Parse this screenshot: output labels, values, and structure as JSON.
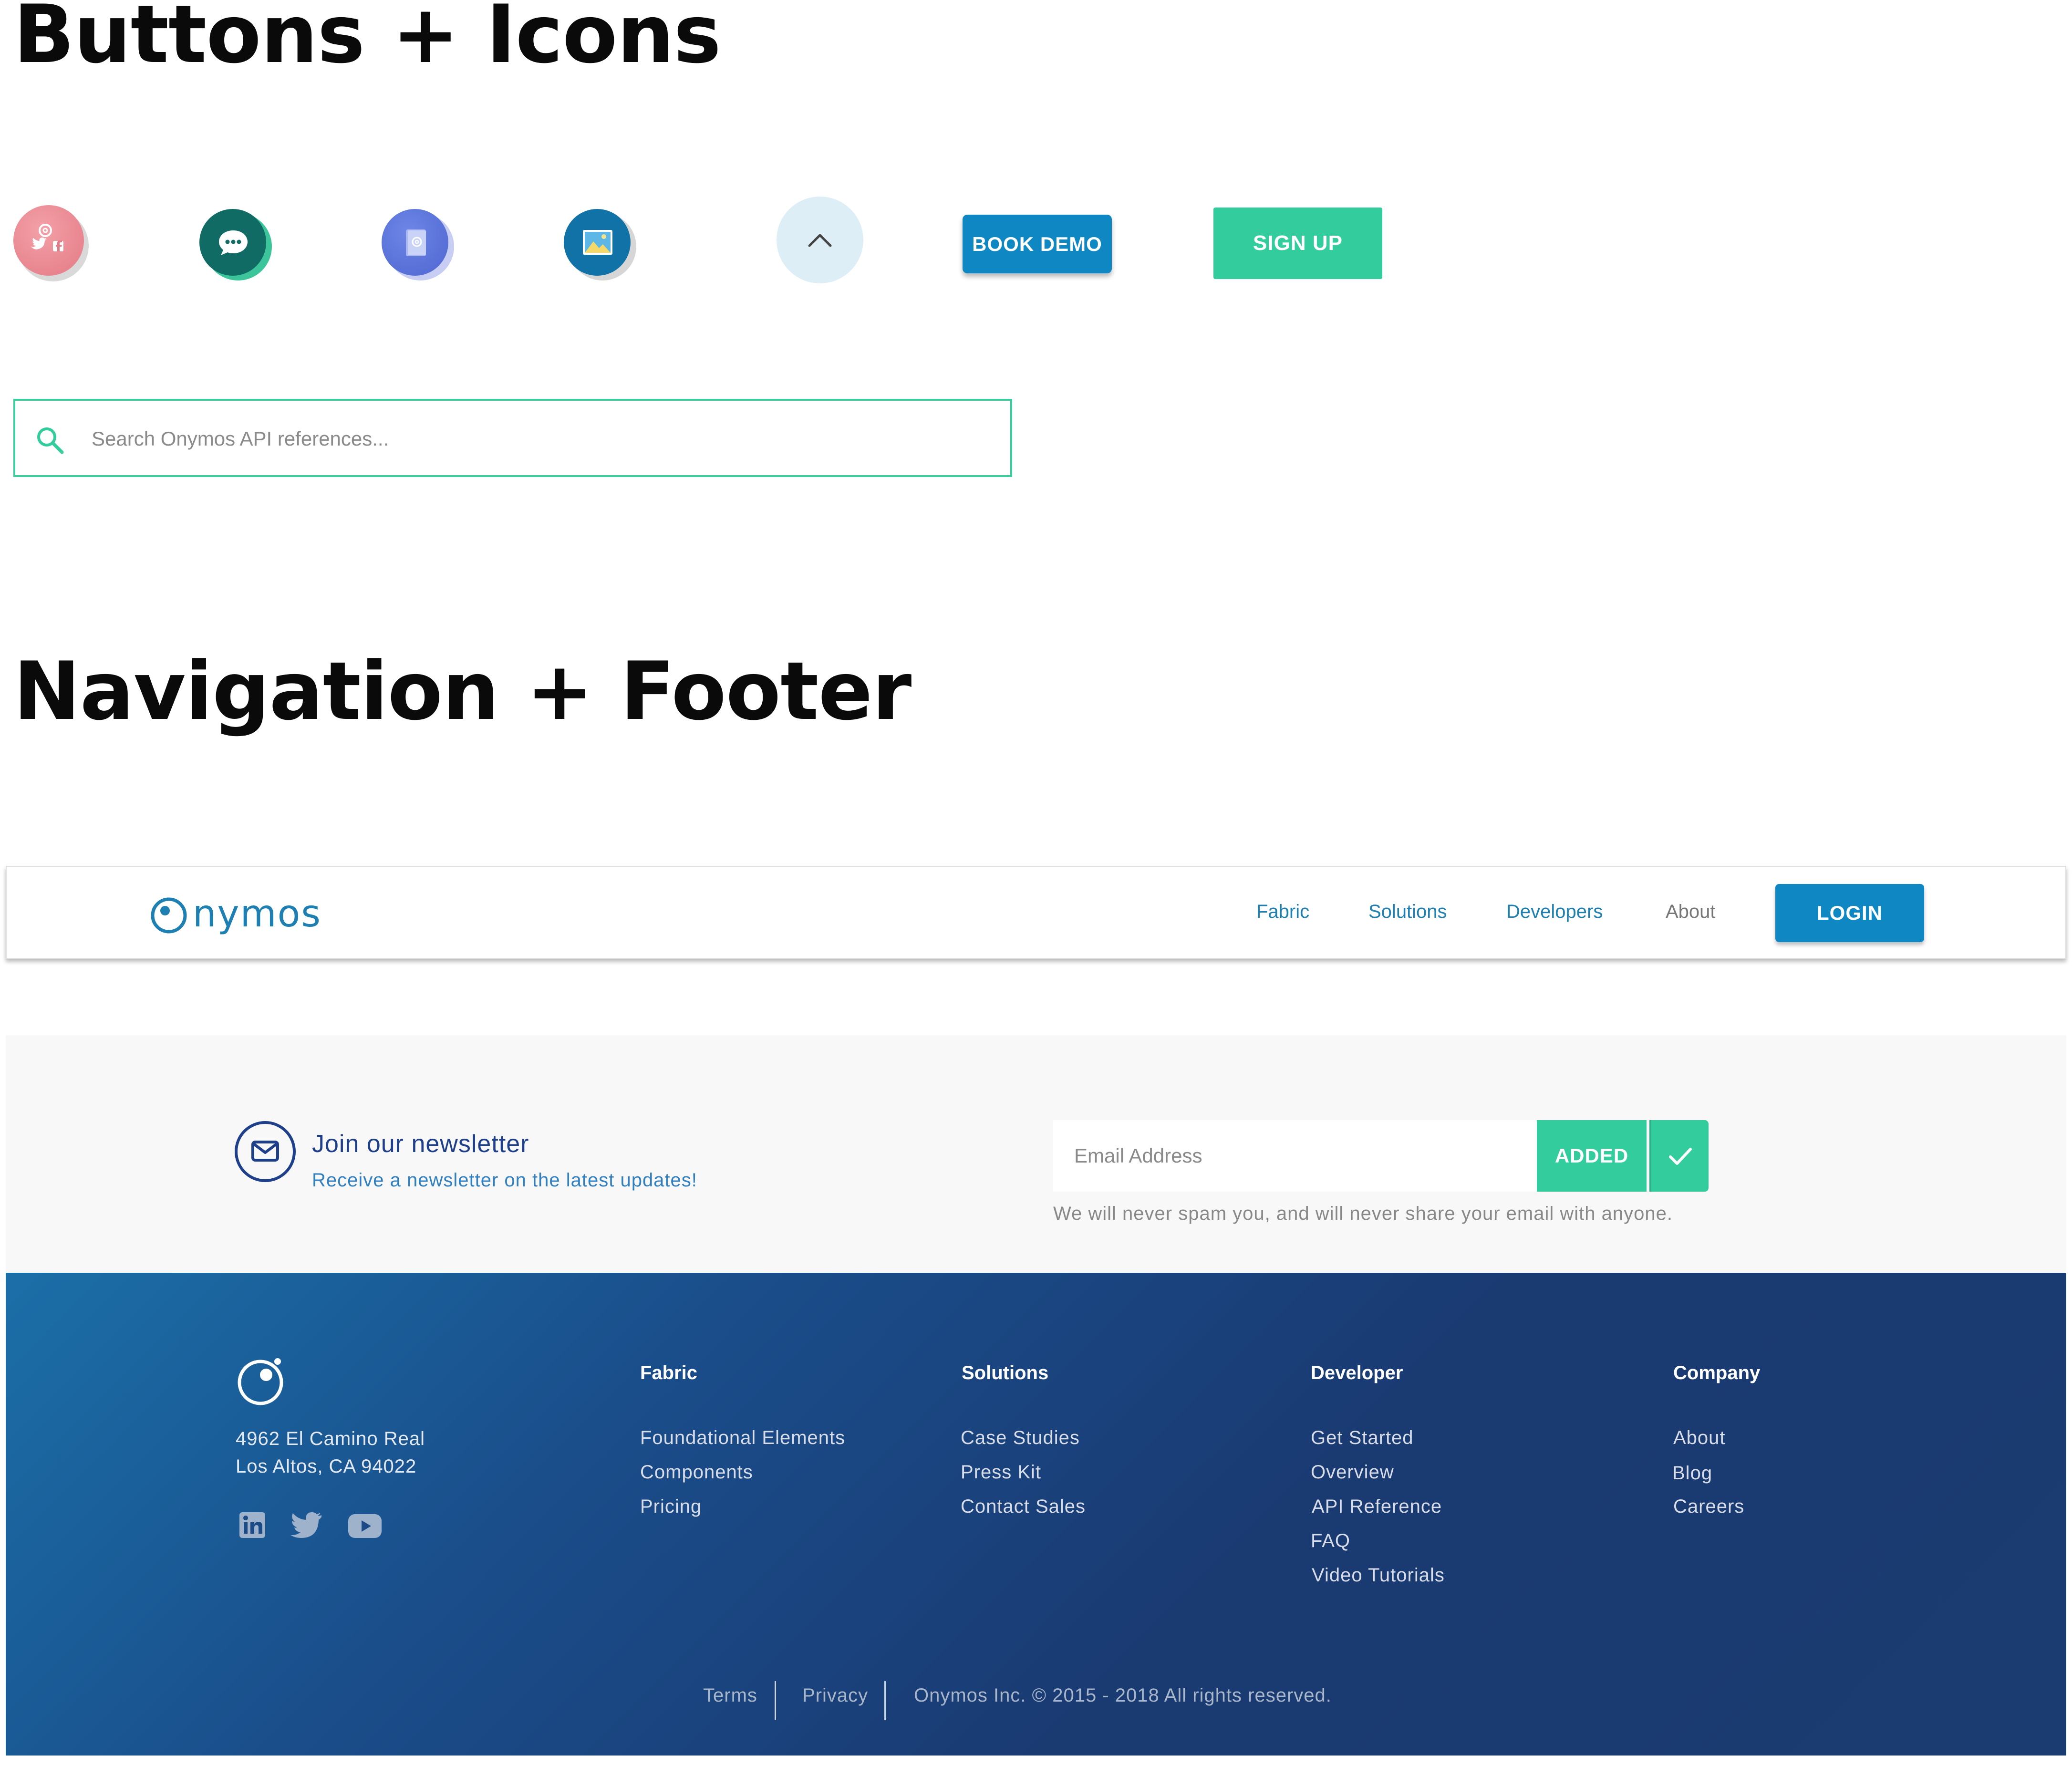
{
  "sections": {
    "buttons_title": "Buttons + Icons",
    "nav_title": "Navigation + Footer"
  },
  "icons": {
    "social_share": "social-share-icon",
    "chat": "chat-bubble-icon",
    "contact_book": "contact-book-icon",
    "image": "image-icon",
    "scroll_up": "chevron-up-icon"
  },
  "buttons": {
    "book_demo": "BOOK DEMO",
    "sign_up": "SIGN UP"
  },
  "search": {
    "placeholder": "Search Onymos API references..."
  },
  "navbar": {
    "logo_text": "nymos",
    "links": [
      "Fabric",
      "Solutions",
      "Developers",
      "About"
    ],
    "login": "LOGIN"
  },
  "newsletter": {
    "title": "Join our newsletter",
    "subtitle": "Receive a newsletter on the latest updates!",
    "email_placeholder": "Email Address",
    "button": "ADDED",
    "disclaimer": "We will never spam you, and will never share your email with anyone."
  },
  "footer": {
    "address_line1": "4962 El Camino Real",
    "address_line2": "Los Altos, CA 94022",
    "columns": [
      {
        "heading": "Fabric",
        "links": [
          "Foundational Elements",
          "Components",
          "Pricing"
        ]
      },
      {
        "heading": "Solutions",
        "links": [
          "Case Studies",
          "Press Kit",
          "Contact Sales"
        ]
      },
      {
        "heading": "Developer",
        "links": [
          "Get Started",
          "Overview",
          "API Reference",
          "FAQ",
          "Video Tutorials"
        ]
      },
      {
        "heading": "Company",
        "links": [
          "About",
          "Blog",
          "Careers"
        ]
      }
    ],
    "bottom": {
      "terms": "Terms",
      "privacy": "Privacy",
      "copyright": "Onymos  Inc. © 2015 - 2018  All rights reserved."
    }
  },
  "colors": {
    "accent_green": "#33cc9c",
    "accent_blue": "#0e87c2",
    "nav_link": "#1e7fb3",
    "footer_dark": "#1a3a72"
  }
}
